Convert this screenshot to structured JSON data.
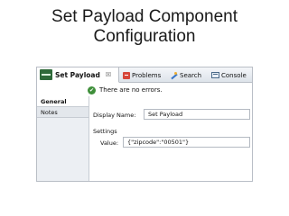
{
  "slide": {
    "title_line1": "Set Payload Component",
    "title_line2": "Configuration"
  },
  "tabs": {
    "active": {
      "label": "Set Payload",
      "close": "☒",
      "icon": "set-payload-icon"
    },
    "problems": {
      "label": "Problems",
      "icon": "problems-icon"
    },
    "search": {
      "label": "Search",
      "icon": "search-icon"
    },
    "console": {
      "label": "Console",
      "icon": "console-icon"
    }
  },
  "status": {
    "message": "There are no errors.",
    "icon": "check-icon",
    "glyph": "✔",
    "color": "#3f8f3a"
  },
  "sidebar": {
    "items": [
      {
        "label": "General"
      },
      {
        "label": "Notes"
      }
    ]
  },
  "form": {
    "display_name_label": "Display Name:",
    "display_name_value": "Set Payload",
    "settings_label": "Settings",
    "value_label": "Value:",
    "value_value": "{\"zipcode\":\"00501\"}"
  }
}
